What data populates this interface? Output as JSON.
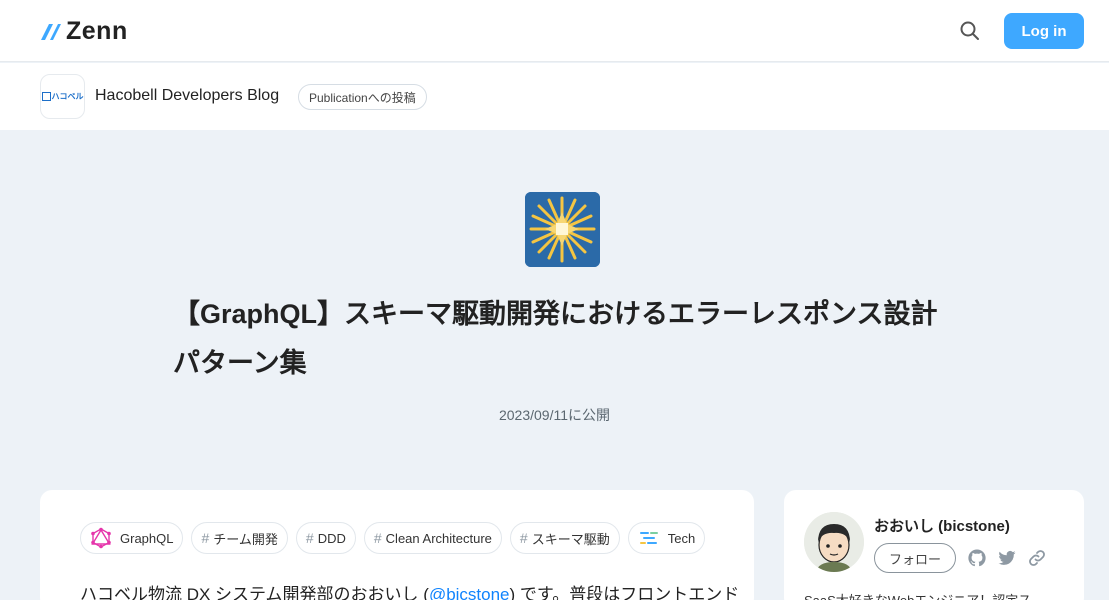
{
  "header": {
    "logo_text": "Zenn",
    "search_icon": "search-icon",
    "login_label": "Log in",
    "accent": "#3ea8ff"
  },
  "publication": {
    "logo_text": "ハコベル",
    "name": "Hacobell Developers Blog",
    "badge": "Publicationへの投稿"
  },
  "article": {
    "emoji": "sparkle-emoji",
    "title": "【GraphQL】スキーマ駆動開発におけるエラーレスポンス設計パターン集",
    "date": "2023/09/11に公開",
    "tags": [
      {
        "label": "GraphQL",
        "icon": "graphql-icon"
      },
      {
        "label": "チーム開発",
        "icon": "#"
      },
      {
        "label": "DDD",
        "icon": "#"
      },
      {
        "label": "Clean Architecture",
        "icon": "#"
      },
      {
        "label": "スキーマ駆動",
        "icon": "#"
      },
      {
        "label": "Tech",
        "icon": "tech-icon"
      }
    ],
    "intro_before": "ハコベル物流 DX システム開発部のおおいし (",
    "intro_link": "@bicstone",
    "intro_after": ") です。普段はフロントエンド"
  },
  "author": {
    "name": "おおいし (bicstone)",
    "follow_label": "フォロー",
    "social_icons": [
      "github-icon",
      "twitter-icon",
      "link-icon"
    ],
    "bio": "SaaS大好きなWebエンジニア！認定ス"
  }
}
